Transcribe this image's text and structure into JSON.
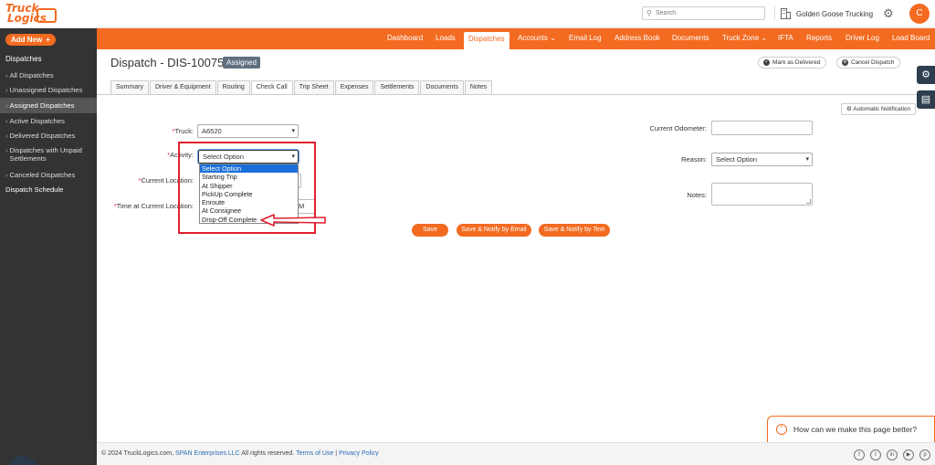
{
  "header": {
    "logo_line1": "Truck",
    "logo_line2": "Logics",
    "search_placeholder": "Search",
    "company": "Golden Goose Trucking",
    "avatar_initial": "C"
  },
  "sidebar": {
    "add_new": "Add New",
    "section": "Dispatches",
    "items": [
      {
        "label": "All Dispatches"
      },
      {
        "label": "Unassigned Dispatches"
      },
      {
        "label": "Assigned Dispatches"
      },
      {
        "label": "Active Dispatches"
      },
      {
        "label": "Delivered Dispatches"
      },
      {
        "label": "Dispatches with Unpaid",
        "label2": "Settlements"
      },
      {
        "label": "Canceled Dispatches"
      }
    ],
    "schedule": "Dispatch Schedule"
  },
  "nav": {
    "items": [
      "Dashboard",
      "Loads",
      "Dispatches",
      "Accounts",
      "Email Log",
      "Address Book",
      "Documents",
      "Truck Zone",
      "IFTA",
      "Reports",
      "Driver Log",
      "Load Board"
    ],
    "active": "Dispatches"
  },
  "page": {
    "title": "Dispatch - DIS-10075",
    "status": "Assigned",
    "mark_delivered": "Mark as Delivered",
    "cancel_dispatch": "Cancel Dispatch"
  },
  "tabs": [
    "Summary",
    "Driver & Equipment",
    "Routing",
    "Check Call",
    "Trip Sheet",
    "Expenses",
    "Settlements",
    "Documents",
    "Notes"
  ],
  "form": {
    "automatic_notification": "Automatic Notification",
    "truck_label": "Truck:",
    "truck_value": "A6520",
    "activity_label": "Activity:",
    "activity_value": "Select Option",
    "current_location_label": "Current Location:",
    "time_label": "Time at Current Location:",
    "time_partial": "M",
    "odometer_label": "Current Odometer:",
    "reason_label": "Reason:",
    "reason_value": "Select Option",
    "notes_label": "Notes:",
    "activity_options": [
      "Select Option",
      "Starting Trip",
      "At Shipper",
      "PickUp Complete",
      "Enroute",
      "At Consignee",
      "Drop-Off Complete"
    ]
  },
  "buttons": {
    "save": "Save",
    "save_email": "Save & Notify by Email",
    "save_text": "Save & Notify by Text"
  },
  "feedback": "How can we make this page better?",
  "footer": {
    "copyright": "© 2024 TruckLogics.com,",
    "span": "SPAN Enterprises LLC",
    "rights": "All rights reserved.",
    "terms": "Terms of Use",
    "sep": "|",
    "privacy": "Privacy Policy"
  },
  "colors": {
    "brand": "#f26b21",
    "sidebar_bg": "#333333",
    "highlight": "#e02030",
    "selected_option": "#1a6fd8"
  }
}
